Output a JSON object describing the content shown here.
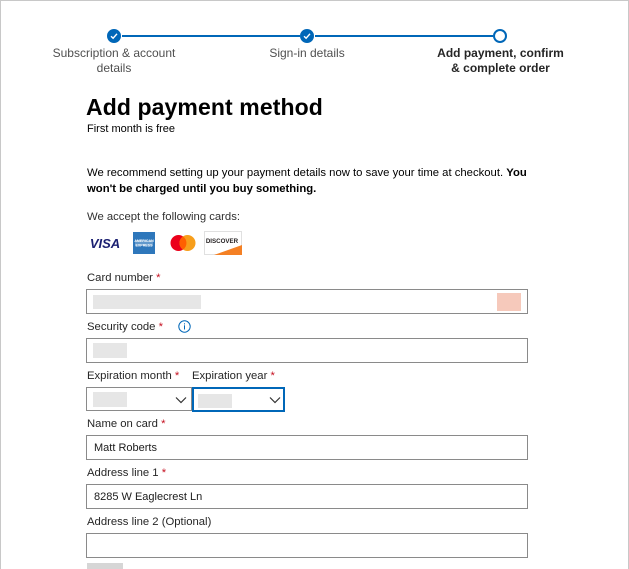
{
  "stepper": {
    "steps": [
      {
        "label_line1": "Subscription & account",
        "label_line2": "details",
        "state": "done"
      },
      {
        "label_line1": "Sign-in details",
        "label_line2": "",
        "state": "done"
      },
      {
        "label_line1": "Add payment, confirm",
        "label_line2": "& complete order",
        "state": "current"
      }
    ]
  },
  "page": {
    "title": "Add payment method",
    "subtitle": "First month is free",
    "recommend_text": "We recommend setting up your payment details now to save your time at checkout.",
    "recommend_bold": "You won't be charged until you buy something.",
    "accept_text": "We accept the following cards:"
  },
  "cards": [
    {
      "name": "visa-icon",
      "text": "VISA"
    },
    {
      "name": "amex-icon",
      "text": "AMERICAN EXPRESS"
    },
    {
      "name": "mastercard-icon",
      "text": ""
    },
    {
      "name": "discover-icon",
      "text": "DISCOVER"
    }
  ],
  "form": {
    "card_number_label": "Card number",
    "security_code_label": "Security code",
    "expiration_month_label": "Expiration month",
    "expiration_year_label": "Expiration year",
    "name_on_card_label": "Name on card",
    "name_on_card_value": "Matt Roberts",
    "address1_label": "Address line 1",
    "address1_value": "8285 W Eaglecrest Ln",
    "address2_label": "Address line 2 (Optional)",
    "address2_value": "",
    "required_mark": "*"
  },
  "colors": {
    "accent": "#0067b8",
    "required": "#c50f1f"
  }
}
